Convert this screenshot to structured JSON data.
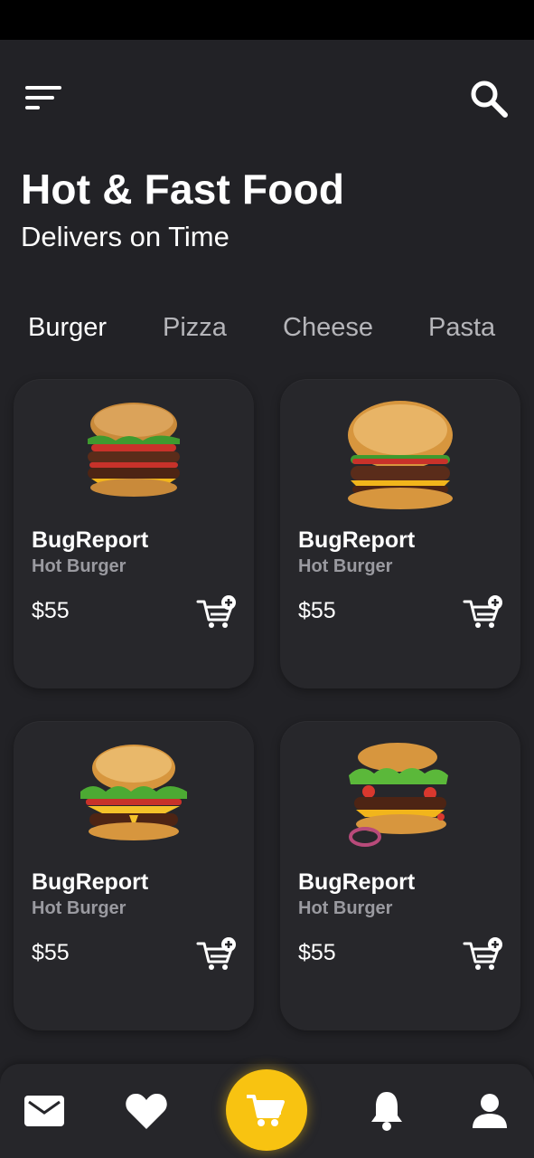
{
  "header": {
    "title": "Hot & Fast Food",
    "subtitle": "Delivers on Time",
    "menu_icon": "menu-icon",
    "search_icon": "search-icon"
  },
  "categories": [
    {
      "label": "Burger",
      "active": true
    },
    {
      "label": "Pizza",
      "active": false
    },
    {
      "label": "Cheese",
      "active": false
    },
    {
      "label": "Pasta",
      "active": false
    }
  ],
  "products": [
    {
      "name": "BugReport",
      "subtitle": "Hot Burger",
      "price": "$55"
    },
    {
      "name": "BugReport",
      "subtitle": "Hot Burger",
      "price": "$55"
    },
    {
      "name": "BugReport",
      "subtitle": "Hot Burger",
      "price": "$55"
    },
    {
      "name": "BugReport",
      "subtitle": "Hot Burger",
      "price": "$55"
    }
  ],
  "bottom_nav": {
    "items": [
      "mail-icon",
      "heart-icon",
      "cart-icon",
      "bell-icon",
      "user-icon"
    ],
    "accent_color": "#f8c311"
  },
  "colors": {
    "background": "#222226",
    "card": "#27272b",
    "muted_text": "#9a9aa0",
    "accent": "#f8c311"
  }
}
